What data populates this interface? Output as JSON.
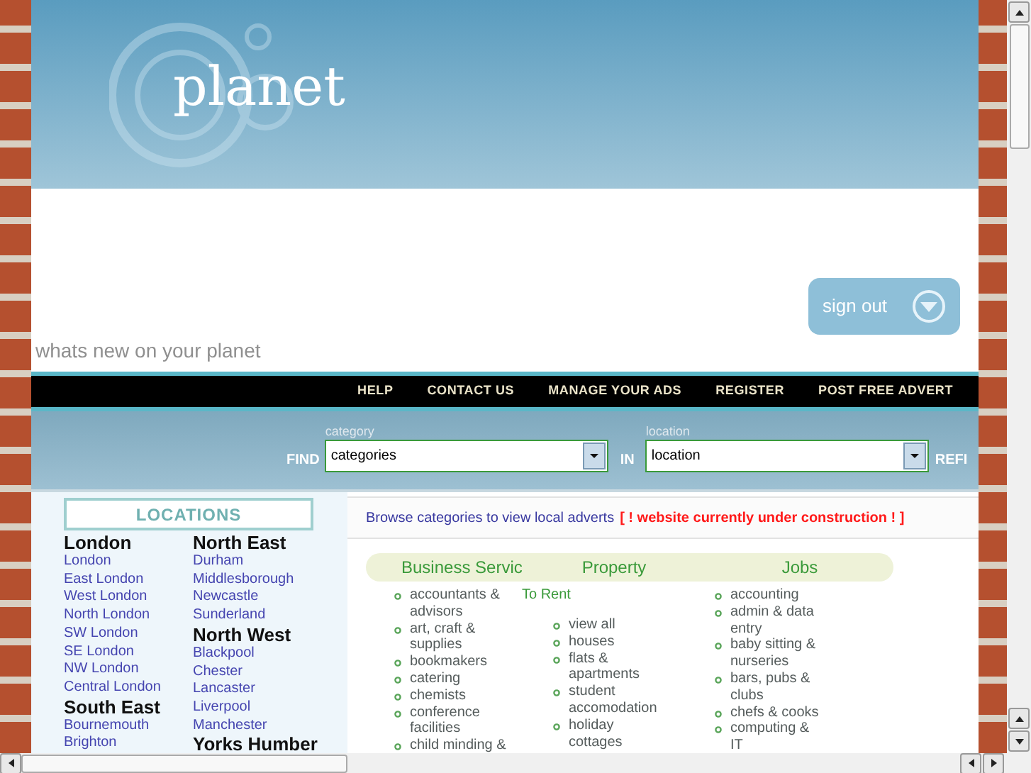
{
  "header": {
    "logo": "planet",
    "sign_out": "sign out",
    "tagline": "whats new on your planet"
  },
  "nav": [
    "HELP",
    "CONTACT US",
    "MANAGE YOUR ADS",
    "REGISTER",
    "POST FREE ADVERT"
  ],
  "search": {
    "find_label": "FIND",
    "category": {
      "label": "category",
      "value": "categories"
    },
    "in_label": "IN",
    "location": {
      "label": "location",
      "value": "location"
    },
    "refine_label": "REFI"
  },
  "locations": {
    "title": "LOCATIONS",
    "columns": [
      [
        {
          "region": "London",
          "places": [
            "London",
            "East London",
            "West London",
            "North London",
            "SW London",
            "SE London",
            "NW London",
            "Central London"
          ]
        },
        {
          "region": "South East",
          "places": [
            "Bournemouth",
            "Brighton"
          ]
        }
      ],
      [
        {
          "region": "North East",
          "places": [
            "Durham",
            "Middlesborough",
            "Newcastle",
            "Sunderland"
          ]
        },
        {
          "region": "North West",
          "places": [
            "Blackpool",
            "Chester",
            "Lancaster",
            "Liverpool",
            "Manchester"
          ]
        },
        {
          "region": "Yorks Humber"
        }
      ]
    ]
  },
  "notice": {
    "text": "Browse categories to view local adverts",
    "warning": "[ ! website currently under construction ! ]"
  },
  "categories": [
    {
      "heading": "Business Servic",
      "items": [
        "accountants & advisors",
        "art, craft & supplies",
        "bookmakers",
        "catering",
        "chemists",
        "conference facilities",
        "child minding &"
      ]
    },
    {
      "heading": "Property",
      "subheading": "To Rent",
      "items": [
        "view all",
        "houses",
        "flats & apartments",
        "student accomodation",
        "holiday cottages"
      ]
    },
    {
      "heading": "Jobs",
      "items": [
        "accounting",
        "admin & data entry",
        "baby sitting & nurseries",
        "bars, pubs & clubs",
        "chefs & cooks",
        "computing & IT"
      ]
    }
  ]
}
